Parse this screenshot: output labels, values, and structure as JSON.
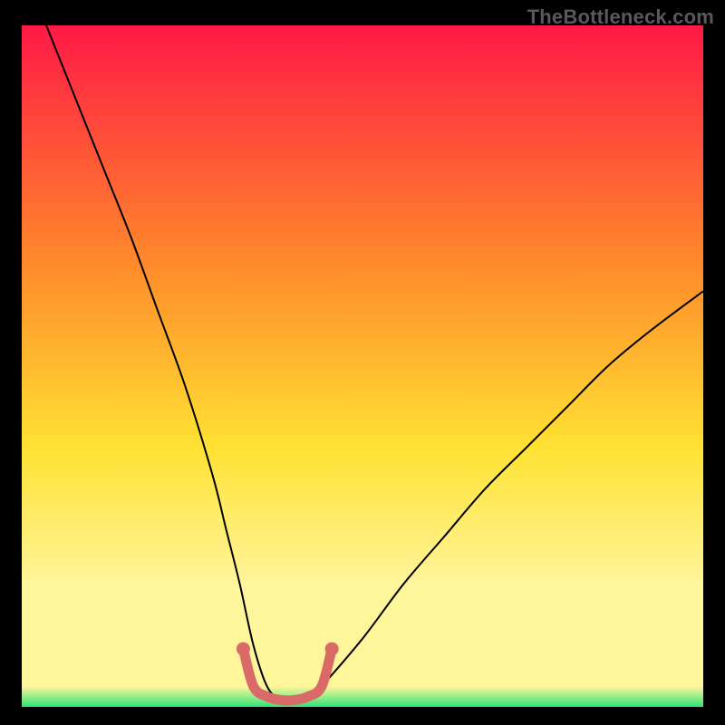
{
  "watermark": "TheBottleneck.com",
  "colors": {
    "background": "#000000",
    "gradient_top": "#ff1946",
    "gradient_mid1": "#ff8a2b",
    "gradient_mid2": "#ffe233",
    "gradient_mid3": "#fff59b",
    "gradient_bottom": "#2fe578",
    "curve": "#000000",
    "marker": "#d96a67"
  },
  "chart_data": {
    "type": "line",
    "title": "",
    "xlabel": "",
    "ylabel": "",
    "xlim": [
      0,
      100
    ],
    "ylim": [
      0,
      100
    ],
    "series": [
      {
        "name": "bottleneck-curve",
        "x": [
          0,
          4,
          8,
          12,
          16,
          20,
          24,
          28,
          30,
          32,
          34,
          36,
          38,
          40,
          42,
          44,
          50,
          56,
          62,
          68,
          74,
          80,
          86,
          92,
          100
        ],
        "y": [
          109,
          99,
          89,
          79,
          69,
          58,
          47,
          34,
          26,
          18,
          9,
          3,
          1,
          1,
          1,
          3,
          10,
          18,
          25,
          32,
          38,
          44,
          50,
          55,
          61
        ]
      }
    ],
    "marker_segment": {
      "name": "minimum-band",
      "x": [
        32.5,
        34,
        36,
        38,
        40,
        42,
        44,
        45.5
      ],
      "y": [
        8.5,
        3,
        1.5,
        1,
        1,
        1.5,
        3,
        8.5
      ]
    }
  }
}
